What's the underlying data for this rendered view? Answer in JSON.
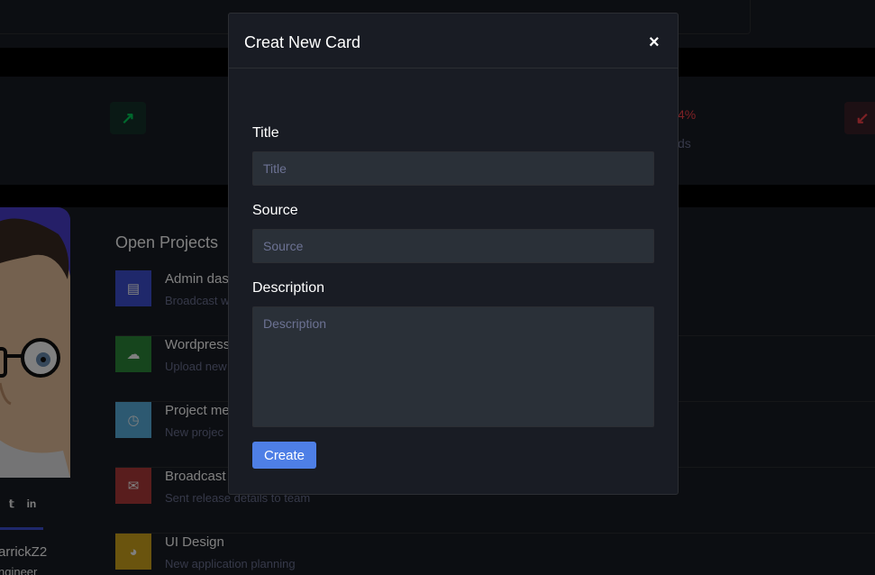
{
  "modal": {
    "title": "Creat New Card",
    "close_label": "×",
    "fields": {
      "title": {
        "label": "Title",
        "placeholder": "Title"
      },
      "source": {
        "label": "Source",
        "placeholder": "Source"
      },
      "description": {
        "label": "Description",
        "placeholder": "Description"
      }
    },
    "create_label": "Create"
  },
  "stats": {
    "up_icon": "arrow-up-right-icon",
    "down_icon": "arrow-down-left-icon",
    "percent_partial": "4%",
    "sub_partial": "ds"
  },
  "projects": {
    "title": "Open Projects",
    "items": [
      {
        "name": "Admin das",
        "desc": "Broadcast w",
        "color": "#3f51d6",
        "icon": "document-icon",
        "glyph": "▤"
      },
      {
        "name": "Wordpress",
        "desc": "Upload new",
        "color": "#2d8a3a",
        "icon": "cloud-download-icon",
        "glyph": "☁"
      },
      {
        "name": "Project me",
        "desc": "New projec",
        "color": "#5bb3e3",
        "icon": "clock-icon",
        "glyph": "◷"
      },
      {
        "name": "Broadcast",
        "desc": "Sent release details to team",
        "color": "#b23a3a",
        "icon": "envelope-open-icon",
        "glyph": "✉"
      },
      {
        "name": "UI Design",
        "desc": "New application planning",
        "color": "#d4a91c",
        "icon": "chart-pie-icon",
        "glyph": "◕"
      }
    ]
  },
  "profile": {
    "name_partial": "arrickZ2",
    "role_partial": "ngineer",
    "twitter_icon": "twitter-icon",
    "linkedin_icon": "linkedin-icon",
    "linkedin_text": "in"
  }
}
